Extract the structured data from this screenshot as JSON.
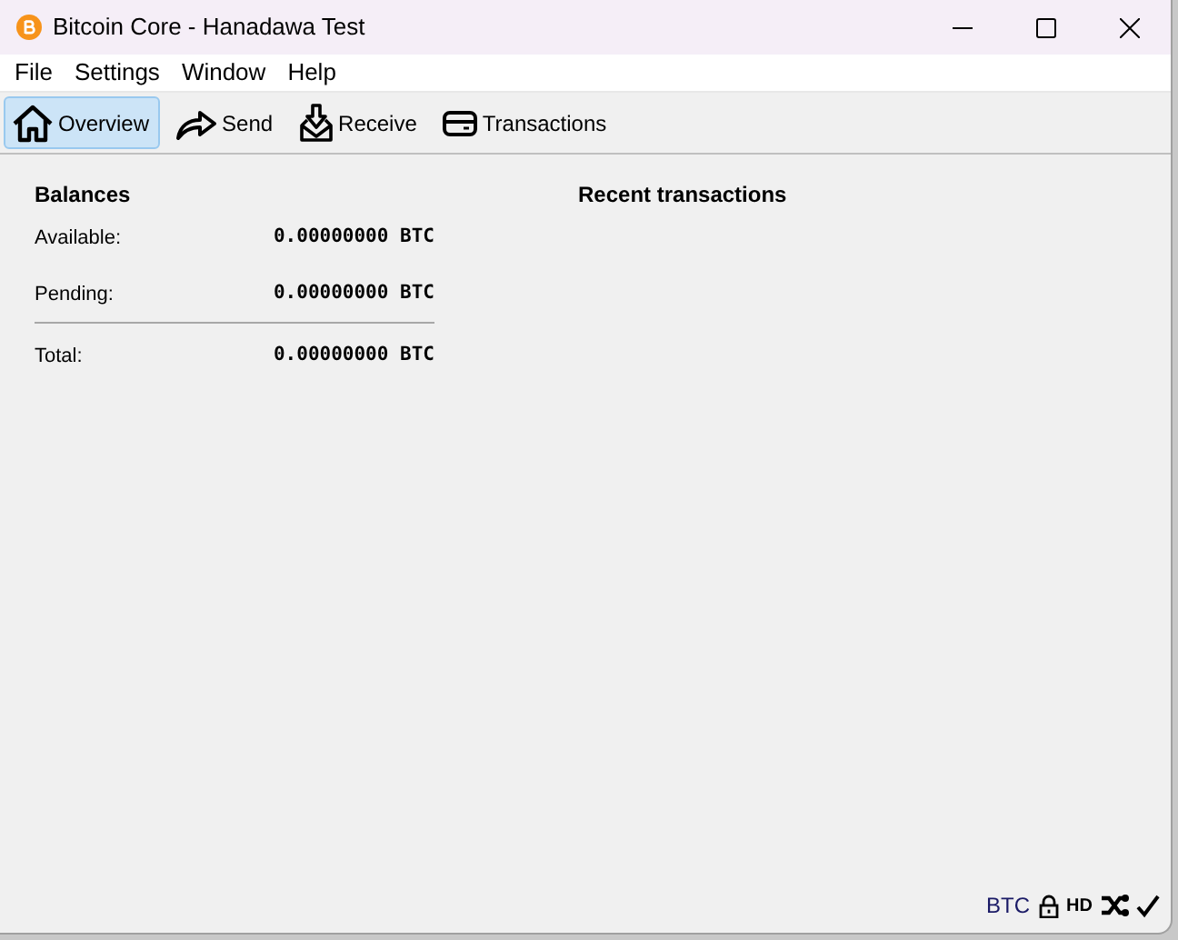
{
  "window": {
    "title": "Bitcoin Core - Hanadawa Test"
  },
  "menu": [
    "File",
    "Settings",
    "Window",
    "Help"
  ],
  "tabs": [
    {
      "label": "Overview",
      "selected": true,
      "kind": "home"
    },
    {
      "label": "Send",
      "selected": false,
      "kind": "send"
    },
    {
      "label": "Receive",
      "selected": false,
      "kind": "receive"
    },
    {
      "label": "Transactions",
      "selected": false,
      "kind": "transactions"
    }
  ],
  "balances": {
    "title": "Balances",
    "rows": [
      {
        "label": "Available:",
        "value": "0.00000000 BTC"
      },
      {
        "label": "Pending:",
        "value": "0.00000000 BTC"
      }
    ],
    "total": {
      "label": "Total:",
      "value": "0.00000000 BTC"
    }
  },
  "recent": {
    "title": "Recent transactions"
  },
  "status_bar": {
    "unit": "BTC",
    "hd": "HD"
  }
}
